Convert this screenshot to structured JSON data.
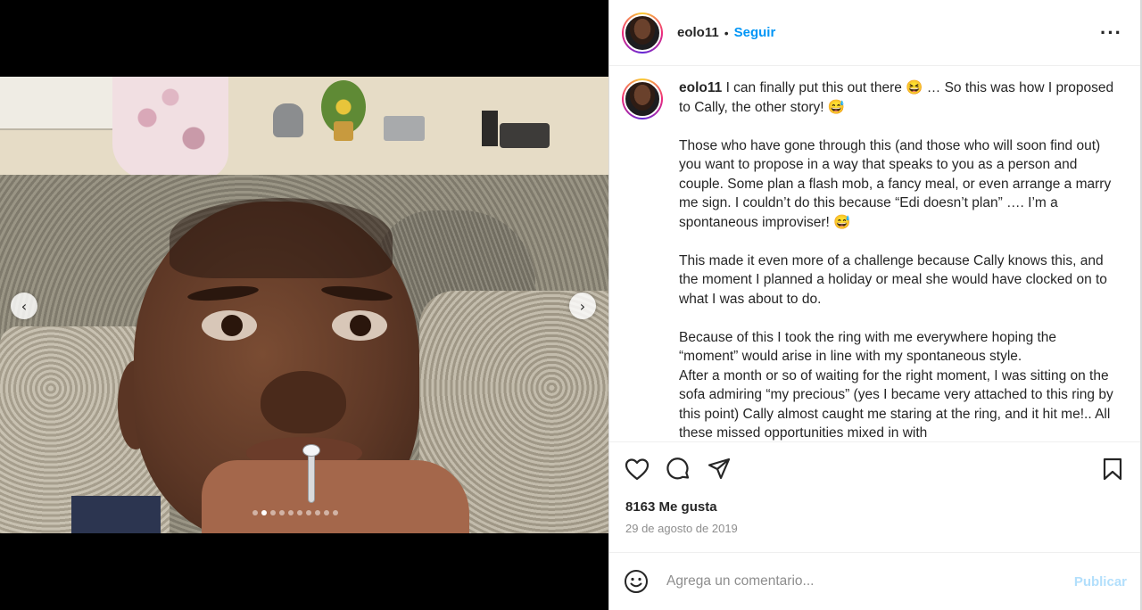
{
  "post": {
    "username": "eolo11",
    "separator": "•",
    "follow_label": "Seguir",
    "more_icon": "more-options-icon",
    "media": {
      "prev_icon": "chevron-left-icon",
      "next_icon": "chevron-right-icon",
      "slide_count": 10,
      "active_slide": 2
    },
    "caption": {
      "username": "eolo11",
      "paragraphs": [
        "I can finally put this out there 😆 … So this was how I proposed to Cally, the other story! 😅",
        "Those who have gone through this (and those who will soon find out) you want to propose in a way that speaks to you as a person and couple. Some plan a flash mob, a fancy meal, or even arrange a marry me sign. I couldn’t do this because “Edi doesn’t plan” …. I’m a spontaneous improviser! 😅",
        "This made it even more of a challenge because Cally knows this, and the moment I planned a holiday or meal she would have clocked on to what I was about to do.",
        "Because of this I took the ring with me everywhere hoping the “moment” would arise in line with my spontaneous style.",
        "After a month or so of waiting for the right moment, I was sitting on the sofa admiring “my precious” (yes I became very attached to this ring by this point) Cally almost caught me staring at the ring, and it hit me!.. All these missed opportunities mixed in with"
      ]
    },
    "actions": {
      "like_icon": "heart-icon",
      "comment_icon": "comment-icon",
      "share_icon": "share-icon",
      "save_icon": "bookmark-icon"
    },
    "likes_text": "8163 Me gusta",
    "date_text": "29 de agosto de 2019",
    "comment": {
      "emoji_icon": "emoji-icon",
      "placeholder": "Agrega un comentario...",
      "value": "",
      "publish_label": "Publicar"
    }
  },
  "colors": {
    "accent": "#0095f6",
    "publish_disabled": "#b2dffc",
    "muted": "#8e8e8e"
  }
}
